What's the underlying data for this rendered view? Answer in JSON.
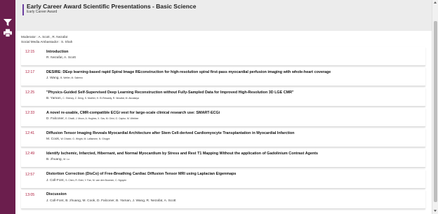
{
  "header": {
    "title": "Early Career Award Scientific Presentations - Basic Science",
    "subtitle": "Early Career Award",
    "accent_color": "#6b3fa0"
  },
  "meta": {
    "moderator": "Moderator : A. Scott ,  R. Nezafat",
    "ambassador": "Social Media Ambassador : S. Shah"
  },
  "rail": {
    "color": "#6b1e4d",
    "icons": [
      "filter-icon",
      "print-icon"
    ]
  },
  "time_color": "#b02040",
  "sessions": [
    {
      "time": "12:15",
      "title": "Introduction",
      "authors": "R. Nezafat, A. Scott",
      "coauthors": ""
    },
    {
      "time": "12:17",
      "title": "DESIRE: DEep learning-based rapid Spiral Image REconstruction for high-resolution spiral first-pass myocardial perfusion imaging with whole-heart coverage",
      "authors": "J. Wang, ",
      "coauthors": "B. Weller, M. Salerno"
    },
    {
      "time": "12:25",
      "title": "\"Physics-Guided Self-Supervised Deep Learning Reconstruction without Fully-Sampled Data for Improved High-Resolution 3D LGE CMR\"",
      "authors": "B. Yaman, ",
      "coauthors": "C. Shenoy, Z. Deng, S. Moeller, H. El-Rewaidy, R. Nezafat, M. Akcakaya"
    },
    {
      "time": "12:33",
      "title": "A novel re-usable, CMR-compatible ECGi vest for large-scale clinical research use: SMART-ECGi",
      "authors": "D. Falconer, ",
      "coauthors": "E. Dhalli, J. Moon, A. Hughes, X. Sav, M. Orini, G. Captur, M. Webber"
    },
    {
      "time": "12:41",
      "title": "Diffusion Tensor Imaging Reveals Myocardial Architecture after Stem Cell-derived Cardiomyocyte Transplantation in Myocardial Infarction",
      "authors": "M. Cook, ",
      "coauthors": "W. Dhahri, G. Wright, M. Laflamme, N. Ghugre"
    },
    {
      "time": "12:49",
      "title": "Identify Ischemic, Infarcted, Hibernant, and Normal Myocardium by Stress and Rest T1 Mapping Without the application of Gadolinium Contrast Agents",
      "authors": "B. zhuang, ",
      "coauthors": "M. Lu"
    },
    {
      "time": "12:57",
      "title": "Distortion Correction (DisCo) of Free-Breathing Cardiac Diffusion Tensor MRI using Laplacian Eigenmaps",
      "authors": "J. Coll-Font, ",
      "coauthors": "S. Chen, R. Eder, Y. Fan, M. van den Boomen, C. Nguyen"
    },
    {
      "time": "13:05",
      "title": "Discussion",
      "authors": "J. Coll-Font, B. zhuang, M. Cook, D. Falconer, B. Yaman, J. Wang, R. Nezafat, A. Scott",
      "coauthors": ""
    }
  ]
}
